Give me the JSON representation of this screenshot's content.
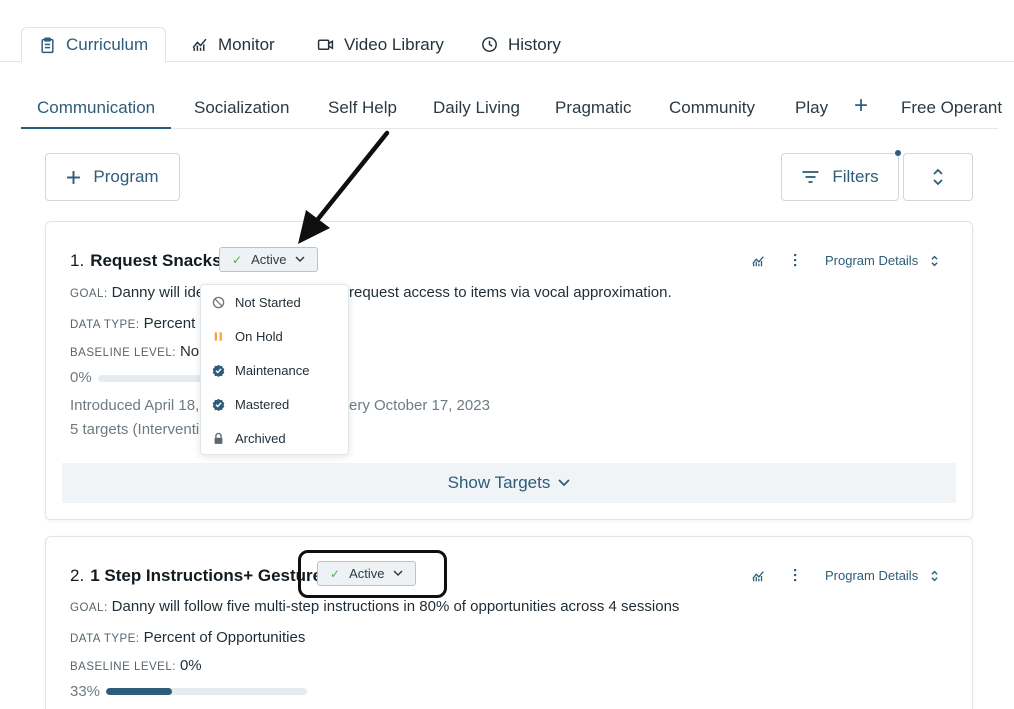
{
  "top_tabs": [
    {
      "label": "Curriculum",
      "icon": "clipboard-icon",
      "active": true
    },
    {
      "label": "Monitor",
      "icon": "chart-icon",
      "active": false
    },
    {
      "label": "Video Library",
      "icon": "video-icon",
      "active": false
    },
    {
      "label": "History",
      "icon": "clock-icon",
      "active": false
    }
  ],
  "sub_tabs": [
    {
      "label": "Communication",
      "active": true
    },
    {
      "label": "Socialization"
    },
    {
      "label": "Self Help"
    },
    {
      "label": "Daily Living"
    },
    {
      "label": "Pragmatic"
    },
    {
      "label": "Community"
    },
    {
      "label": "Play"
    },
    {
      "label": "+"
    },
    {
      "label": "Free Operant"
    }
  ],
  "toolbar": {
    "program_label": "Program",
    "filters_label": "Filters"
  },
  "programs": [
    {
      "number": "1.",
      "title": "Request Snacks",
      "status": "Active",
      "details_label": "Program Details",
      "goal_label": "GOAL:",
      "goal_left": "Danny will ider",
      "goal_right": "request access to items via vocal approximation.",
      "data_type_label": "DATA TYPE:",
      "data_type": "Percent c",
      "baseline_label": "BASELINE LEVEL:",
      "baseline": "Non",
      "progress_text": "0%",
      "progress_fraction": 0.0,
      "introduced_left": "Introduced April 18, 2",
      "introduced_right": "ery October 17, 2023",
      "targets_text": "5 targets (Interventi",
      "show_targets_label": "Show Targets"
    },
    {
      "number": "2.",
      "title": "1 Step Instructions+ Gesture",
      "status": "Active",
      "details_label": "Program Details",
      "goal_label": "GOAL:",
      "goal": "Danny will follow five multi-step instructions in 80% of opportunities across 4 sessions",
      "data_type_label": "DATA TYPE:",
      "data_type": "Percent of Opportunities",
      "baseline_label": "BASELINE LEVEL:",
      "baseline": "0%",
      "progress_text": "33%",
      "progress_fraction": 0.33
    }
  ],
  "status_menu": [
    {
      "label": "Not Started",
      "icon": "ban-icon",
      "color": "#6b7780"
    },
    {
      "label": "On Hold",
      "icon": "pause-icon",
      "color": "#f0a23a"
    },
    {
      "label": "Maintenance",
      "icon": "badge-check-icon",
      "color": "#2d5d78"
    },
    {
      "label": "Mastered",
      "icon": "badge-check-icon",
      "color": "#2d5d78"
    },
    {
      "label": "Archived",
      "icon": "lock-icon",
      "color": "#5b666e"
    }
  ],
  "colors": {
    "accent": "#2d5d78",
    "active_check": "#4caf50"
  }
}
